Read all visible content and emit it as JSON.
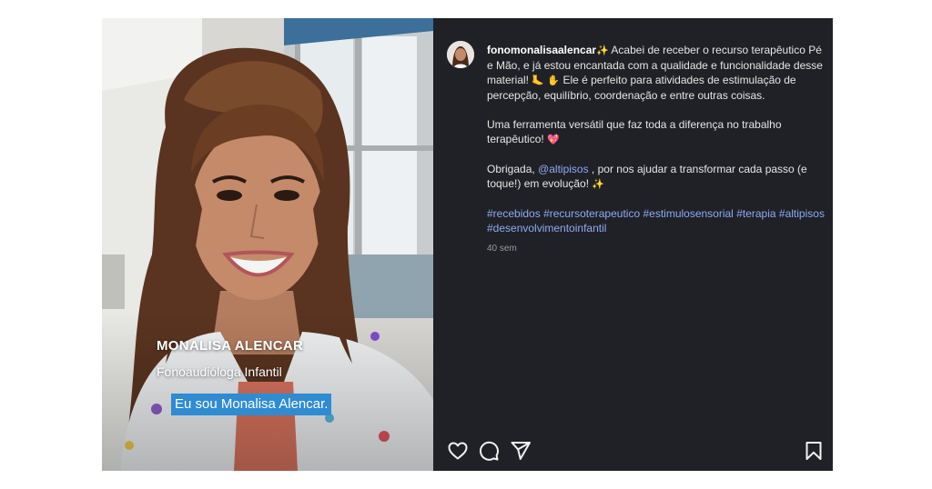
{
  "media": {
    "caption_name": "MONALISA ALENCAR",
    "caption_role": "Fonoaudióloga Infantil",
    "subtitle": "Eu sou Monalisa Alencar."
  },
  "post": {
    "username": "fonomonalisaalencar",
    "caption_p1": " Acabei de receber o recurso terapêutico Pé e Mão, e já estou encantada com a qualidade e funcionalidade desse material! ",
    "caption_p1_end": " Ele é perfeito para atividades de estimulação de percepção, equilíbrio, coordenação e entre outras coisas.",
    "caption_p2": "Uma ferramenta versátil que faz toda a diferença no trabalho terapêutico! ",
    "caption_p3_start": "Obrigada, ",
    "mention": "@altipisos",
    "caption_p3_end": " , por nos ajudar a transformar cada passo (e toque!) em evolução! ",
    "hashtags": [
      "#recebidos",
      "#recursoterapeutico",
      "#estimulosensorial",
      "#terapia",
      "#altipisos",
      "#desenvolvimentoinfantil"
    ],
    "time": "40 sem",
    "emoji": {
      "sparkles": "✨",
      "foot": "🦶",
      "hand": "✋",
      "heart": "💖"
    }
  },
  "icons": {
    "like": "heart-icon",
    "comment": "comment-icon",
    "share": "share-icon",
    "save": "bookmark-icon"
  },
  "colors": {
    "panel_bg": "#202126",
    "link": "#8eaaf5",
    "subtitle_bg": "#2f8bd2"
  }
}
